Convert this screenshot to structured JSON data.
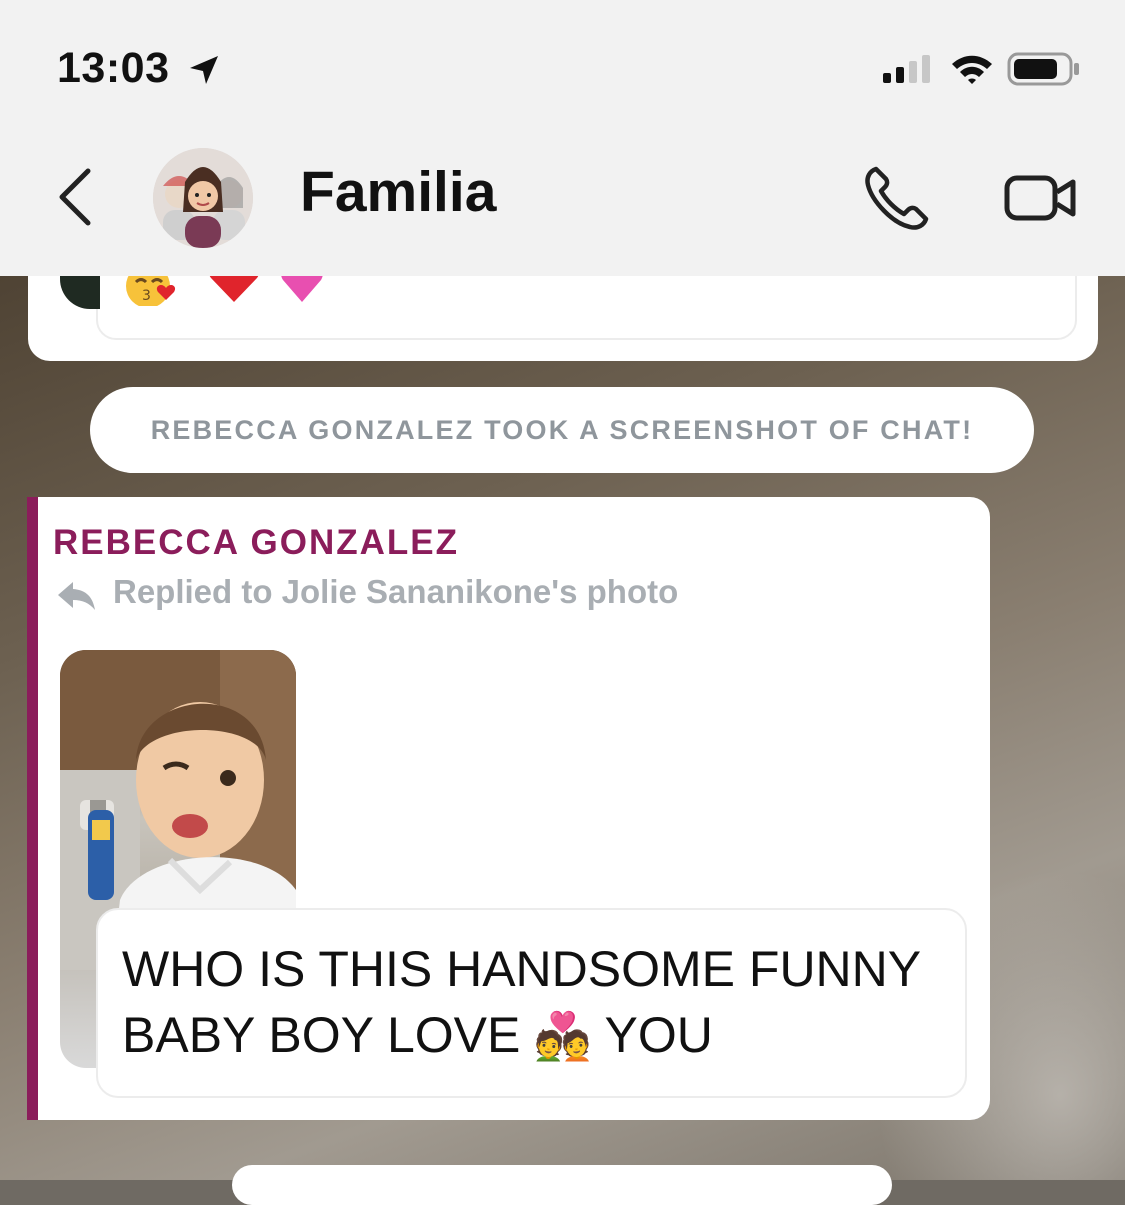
{
  "status_bar": {
    "time": "13:03",
    "icons": [
      "location-arrow-icon",
      "signal-icon",
      "wifi-icon",
      "battery-icon"
    ]
  },
  "header": {
    "title": "Familia",
    "icons": [
      "back-chevron-icon",
      "group-avatar",
      "phone-icon",
      "video-camera-icon"
    ]
  },
  "previous_message": {
    "reactions": [
      "😘",
      "❤️",
      "💗"
    ]
  },
  "system_notice": {
    "text": "REBECCA GONZALEZ TOOK A SCREENSHOT OF CHAT!"
  },
  "message": {
    "sender": "REBECCA GONZALEZ",
    "reply_context": "Replied to Jolie Sananikone's photo",
    "text_line1": "WHO IS THIS HANDSOME FUNNY",
    "text_line2_before": "BABY BOY LOVE ",
    "emoji": "💑",
    "text_line2_after": " YOU",
    "sender_color": "#8b1d5b"
  }
}
